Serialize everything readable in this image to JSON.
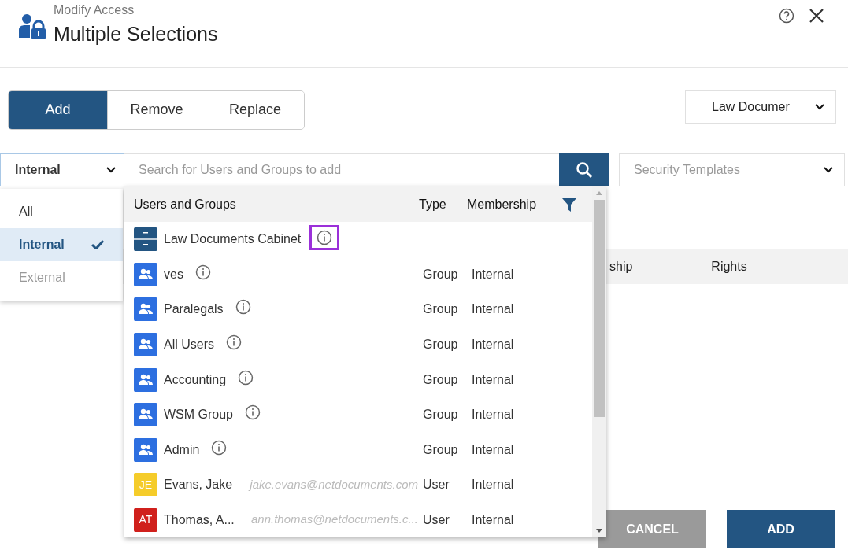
{
  "header": {
    "subtitle": "Modify Access",
    "title": "Multiple Selections"
  },
  "mode_tabs": [
    {
      "label": "Add",
      "selected": true
    },
    {
      "label": "Remove",
      "selected": false
    },
    {
      "label": "Replace",
      "selected": false
    }
  ],
  "cabinet_select": {
    "value": "Law Documer"
  },
  "scope_select": {
    "value": "Internal"
  },
  "search": {
    "placeholder": "Search for Users and Groups to add"
  },
  "template_select": {
    "placeholder": "Security Templates"
  },
  "scope_menu": [
    {
      "label": "All",
      "selected": false,
      "disabled": false
    },
    {
      "label": "Internal",
      "selected": true,
      "disabled": false
    },
    {
      "label": "External",
      "selected": false,
      "disabled": true
    }
  ],
  "access_table": {
    "columns": [
      "ship",
      "Rights"
    ]
  },
  "results": {
    "columns": [
      "Users and Groups",
      "Type",
      "Membership"
    ],
    "rows": [
      {
        "kind": "cabinet",
        "name": "Law Documents Cabinet",
        "info_focused": true
      },
      {
        "kind": "group",
        "name": "ves",
        "type": "Group",
        "membership": "Internal",
        "info_focused": false
      },
      {
        "kind": "group",
        "name": "Paralegals",
        "type": "Group",
        "membership": "Internal",
        "info_focused": false
      },
      {
        "kind": "group",
        "name": "All Users",
        "type": "Group",
        "membership": "Internal",
        "info_focused": false
      },
      {
        "kind": "group",
        "name": "Accounting",
        "type": "Group",
        "membership": "Internal",
        "info_focused": false
      },
      {
        "kind": "group",
        "name": "WSM Group",
        "type": "Group",
        "membership": "Internal",
        "info_focused": false
      },
      {
        "kind": "group",
        "name": "Admin",
        "type": "Group",
        "membership": "Internal",
        "info_focused": false
      },
      {
        "kind": "user",
        "initials": "JE",
        "color": "#f5cc2a",
        "name": "Evans, Jake",
        "email": "jake.evans@netdocuments.com",
        "type": "User",
        "membership": "Internal"
      },
      {
        "kind": "user",
        "initials": "AT",
        "color": "#d0201c",
        "name": "Thomas, A...",
        "email": "ann.thomas@netdocuments.c...",
        "type": "User",
        "membership": "Internal"
      }
    ]
  },
  "footer": {
    "buttons": [
      {
        "label": "CANCEL",
        "kind": "secondary"
      },
      {
        "label": "ADD",
        "kind": "primary"
      }
    ]
  }
}
